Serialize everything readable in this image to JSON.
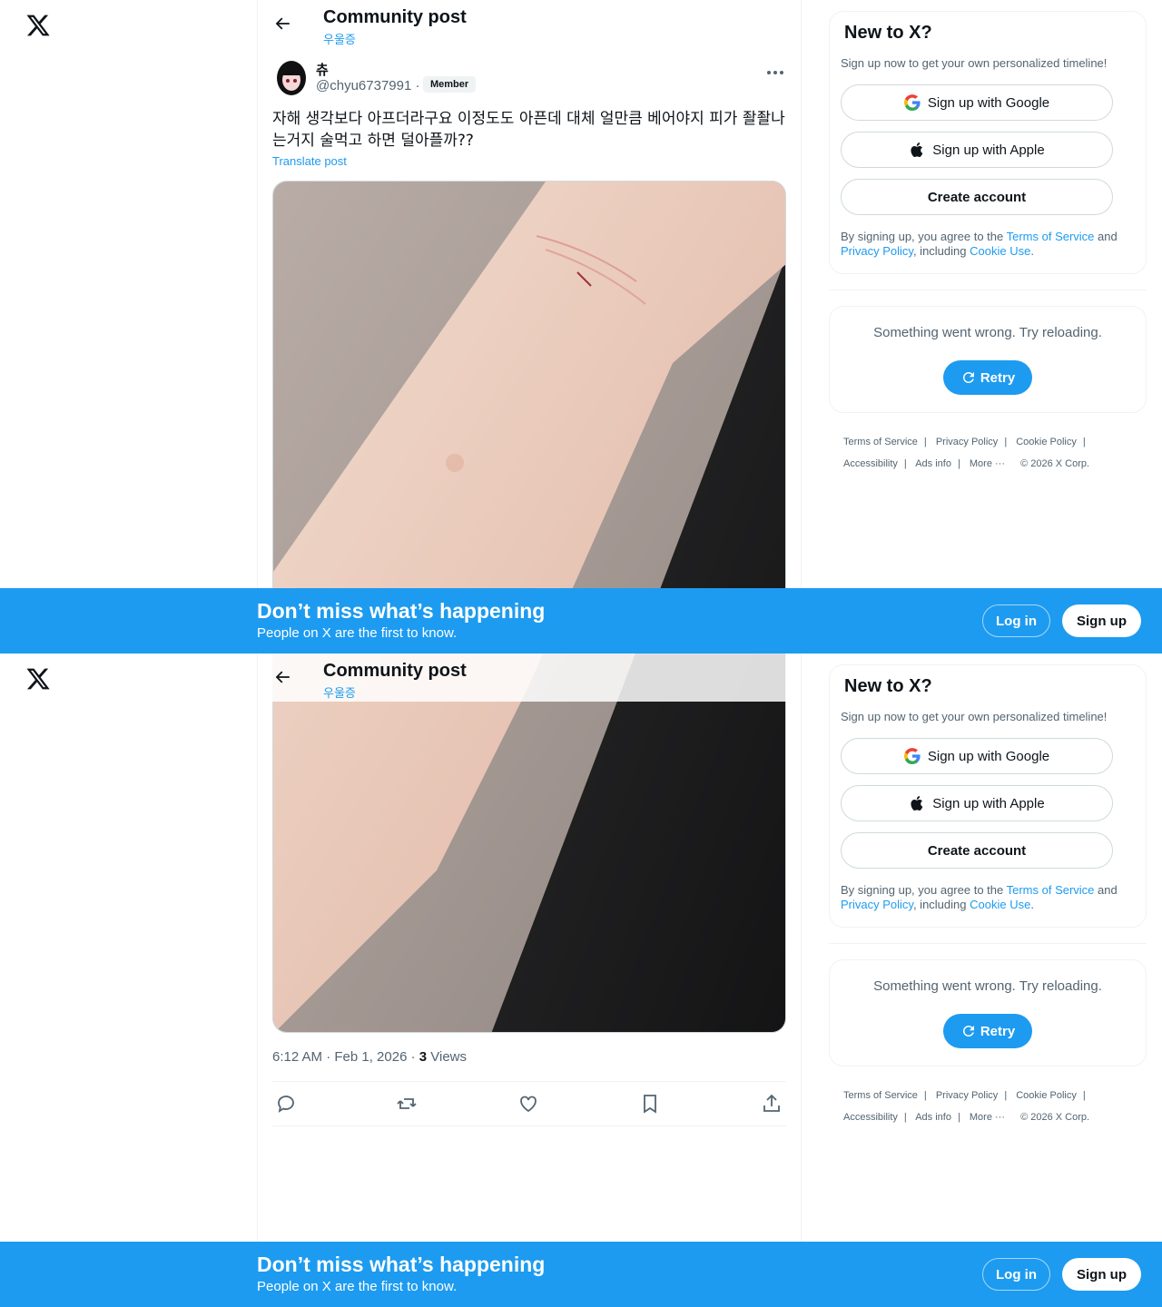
{
  "header": {
    "title": "Community post",
    "community": "우울증"
  },
  "author": {
    "name": "츄",
    "handle": "@chyu6737991 ·",
    "badge": "Member"
  },
  "post": {
    "text": "자해 생각보다 아프더라구요 이정도도 아픈데 대체 얼만큼 베어야지 피가 좔좔나는거지 술먹고 하면 덜아플까??",
    "translate": "Translate post",
    "timestamp": "6:12 AM · Feb 1, 2026 · ",
    "views_count": "3",
    "views_label": " Views"
  },
  "signup_card": {
    "title": "New to X?",
    "subtitle": "Sign up now to get your own personalized timeline!",
    "google": "Sign up with Google",
    "apple": "Sign up with Apple",
    "create": "Create account",
    "legal_prefix": "By signing up, you agree to the ",
    "terms": "Terms of Service",
    "and": " and ",
    "privacy": "Privacy Policy",
    "including": ", including ",
    "cookie": "Cookie Use",
    "period": "."
  },
  "error_card": {
    "message": "Something went wrong. Try reloading.",
    "retry": "Retry"
  },
  "footer": {
    "terms": "Terms of Service",
    "privacy": "Privacy Policy",
    "cookie": "Cookie Policy",
    "accessibility": "Accessibility",
    "ads": "Ads info",
    "more": "More ···",
    "copyright": "© 2026 X Corp."
  },
  "banner": {
    "title": "Don’t miss what’s happening",
    "subtitle": "People on X are the first to know.",
    "login": "Log in",
    "signup": "Sign up"
  },
  "colors": {
    "accent": "#1d9bf0",
    "text": "#0f1419",
    "muted": "#536471"
  },
  "icons": [
    "x-logo-icon",
    "back-arrow-icon",
    "more-icon",
    "google-icon",
    "apple-icon",
    "retry-icon",
    "reply-icon",
    "repost-icon",
    "like-icon",
    "bookmark-icon",
    "share-icon"
  ]
}
